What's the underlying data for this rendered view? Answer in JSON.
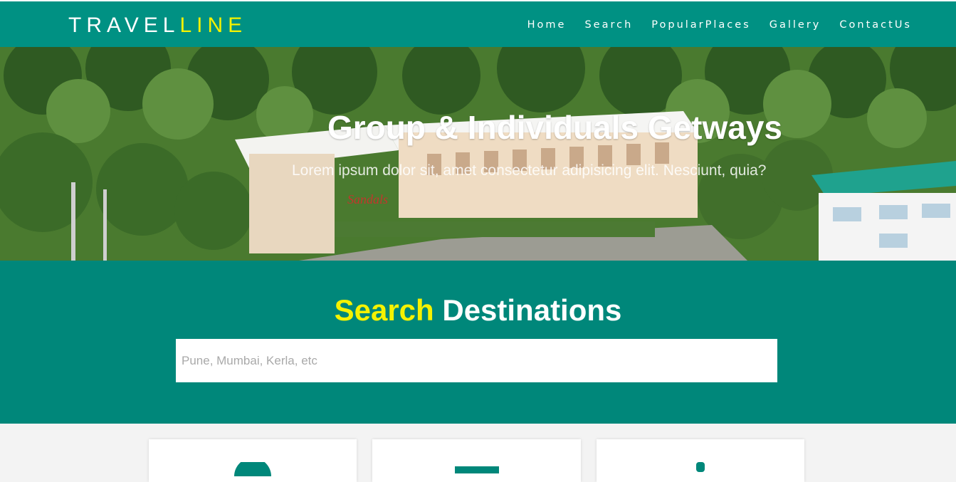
{
  "brand": {
    "part1": "TRAVEL",
    "part2": "LINE"
  },
  "nav": {
    "items": [
      {
        "label": "Home"
      },
      {
        "label": "Search"
      },
      {
        "label": "PopularPlaces"
      },
      {
        "label": "Gallery"
      },
      {
        "label": "ContactUs"
      }
    ]
  },
  "hero": {
    "title": "Group & Individuals Getways",
    "subtitle": "Lorem ipsum dolor sit, amet consectetur adipisicing elit. Nesciunt, quia?",
    "sign": "Sandals"
  },
  "search": {
    "title_accent": "Search",
    "title_rest": " Destinations",
    "placeholder": "Pune, Mumbai, Kerla, etc"
  },
  "cards": [
    {
      "icon": "circle-icon"
    },
    {
      "icon": "bar-icon"
    },
    {
      "icon": "pin-icon"
    }
  ],
  "colors": {
    "primary": "#009183",
    "band": "#00877a",
    "accent": "#f5f200"
  }
}
